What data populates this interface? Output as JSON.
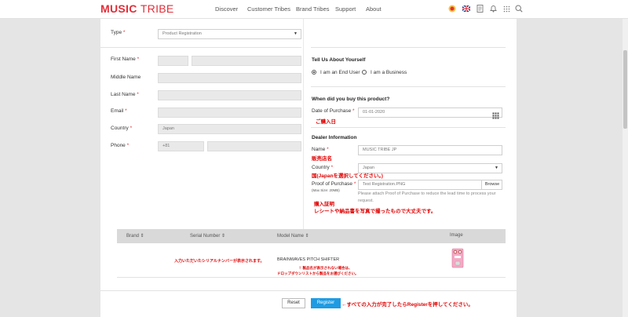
{
  "header": {
    "logo_bold": "MUSIC",
    "logo_thin": "TRIBE",
    "nav": [
      "Discover",
      "Customer Tribes",
      "Brand Tribes",
      "Support",
      "About"
    ]
  },
  "form": {
    "type": {
      "label": "Type",
      "value": "Product Registration"
    },
    "first_name": {
      "label": "First Name"
    },
    "middle_name": {
      "label": "Middle Name"
    },
    "last_name": {
      "label": "Last Name"
    },
    "email": {
      "label": "Email"
    },
    "country": {
      "label": "Country",
      "value": "Japan"
    },
    "phone": {
      "label": "Phone",
      "code": "+81"
    }
  },
  "tell_us": {
    "title": "Tell Us About Yourself",
    "options": [
      "I am an End User",
      "I am a Business"
    ],
    "selected_index": 0
  },
  "purchase": {
    "title": "When did you buy this product?",
    "date_label": "Date of Purchase",
    "date_value": "01-01-2020",
    "annotation": "ご購入日"
  },
  "dealer": {
    "title": "Dealer Information",
    "name_label": "Name",
    "name_value": "MUSIC TRIBE JP",
    "name_annotation": "販売店名",
    "country_label": "Country",
    "country_value": "Japan",
    "country_annotation": "国(Japanを選択してください。)",
    "proof_label": "Proof of Purchase",
    "proof_size": "(Max Size: 20MB)",
    "proof_file": "Test Registration.PNG",
    "browse_label": "Browse",
    "proof_hint": "Please attach Proof of Purchase to reduce the lead time to process your request.",
    "proof_annotation_1": "購入証明",
    "proof_annotation_2": "レシートや納品書を写真で撮ったもので大丈夫です。"
  },
  "table": {
    "headers": [
      "Brand",
      "Serial Number",
      "Model Name",
      "Image"
    ],
    "serial_annotation": "入力いただいたシリアルナンバーが表示されます。",
    "model_name": "BRAINWAVES PITCH SHIFTER",
    "model_annotation_1": "！製品名が表示されない場合は、",
    "model_annotation_2": "ドロップダウンリストから製品をお選びください。"
  },
  "actions": {
    "reset_label": "Reset",
    "register_label": "Register",
    "register_annotation": "←すべての入力が完了したらRegisterを押してください。"
  },
  "colors": {
    "brand_red": "#e22e38",
    "button_blue": "#1e9be2",
    "annotation_red": "#e00000"
  }
}
